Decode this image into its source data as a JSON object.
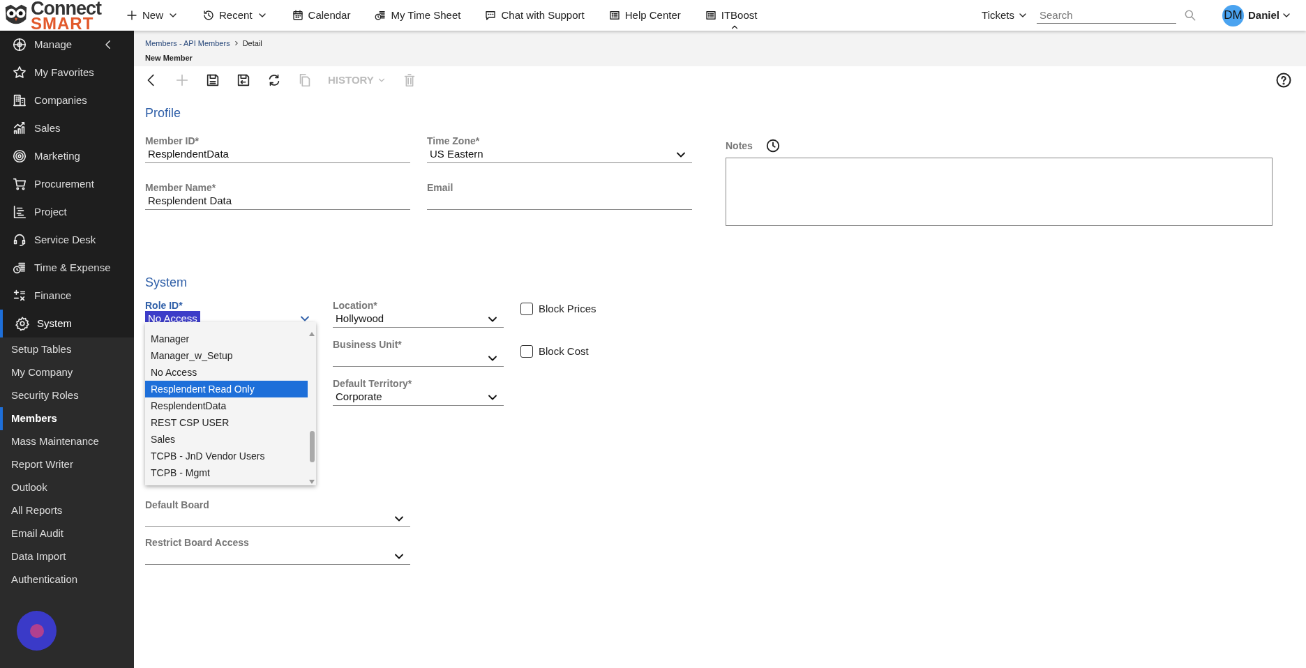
{
  "logo": {
    "line1": "Connect",
    "line2": "SMART"
  },
  "top_nav": [
    {
      "label": "New",
      "caret": true,
      "pointer": false
    },
    {
      "label": "Recent",
      "caret": true,
      "pointer": false
    },
    {
      "label": "Calendar",
      "caret": false,
      "pointer": false
    },
    {
      "label": "My Time Sheet",
      "caret": false,
      "pointer": false
    },
    {
      "label": "Chat with Support",
      "caret": false,
      "pointer": false
    },
    {
      "label": "Help Center",
      "caret": false,
      "pointer": false
    },
    {
      "label": "ITBoost",
      "caret": false,
      "pointer": true
    }
  ],
  "tickets_menu": "Tickets",
  "search": {
    "placeholder": "Search"
  },
  "user": {
    "initials": "DM",
    "name": "Daniel"
  },
  "sidebar": {
    "items": [
      {
        "label": "Manage",
        "selected": false
      },
      {
        "label": "My Favorites",
        "selected": false
      },
      {
        "label": "Companies",
        "selected": false
      },
      {
        "label": "Sales",
        "selected": false
      },
      {
        "label": "Marketing",
        "selected": false
      },
      {
        "label": "Procurement",
        "selected": false
      },
      {
        "label": "Project",
        "selected": false
      },
      {
        "label": "Service Desk",
        "selected": false
      },
      {
        "label": "Time & Expense",
        "selected": false
      },
      {
        "label": "Finance",
        "selected": false
      },
      {
        "label": "System",
        "selected": true
      }
    ],
    "sub_items": [
      {
        "label": "Setup Tables",
        "selected": false
      },
      {
        "label": "My Company",
        "selected": false
      },
      {
        "label": "Security Roles",
        "selected": false
      },
      {
        "label": "Members",
        "selected": true
      },
      {
        "label": "Mass Maintenance",
        "selected": false
      },
      {
        "label": "Report Writer",
        "selected": false
      },
      {
        "label": "Outlook",
        "selected": false
      },
      {
        "label": "All Reports",
        "selected": false
      },
      {
        "label": "Email Audit",
        "selected": false
      },
      {
        "label": "Data Import",
        "selected": false
      },
      {
        "label": "Authentication",
        "selected": false
      }
    ]
  },
  "breadcrumb": {
    "link": "Members - API Members",
    "current": "Detail",
    "page_title": "New Member"
  },
  "toolbar": [
    {
      "kind": "back",
      "disabled": false
    },
    {
      "kind": "add",
      "disabled": true
    },
    {
      "kind": "save",
      "disabled": false
    },
    {
      "kind": "save_close",
      "disabled": false
    },
    {
      "kind": "refresh",
      "disabled": false
    },
    {
      "kind": "copy",
      "disabled": true
    },
    {
      "kind": "history",
      "label": "HISTORY",
      "disabled": true
    },
    {
      "kind": "delete",
      "disabled": true
    }
  ],
  "profile": {
    "heading": "Profile",
    "fields": [
      {
        "label": "Member ID*",
        "value": "ResplendentData",
        "kind": "text",
        "focused": false
      },
      {
        "label": "Time Zone*",
        "value": "US Eastern",
        "kind": "select",
        "focused": false
      },
      {
        "label": "Member Name*",
        "value": "Resplendent Data",
        "kind": "text",
        "focused": false
      },
      {
        "label": "Email",
        "kind": "text",
        "focused": false
      }
    ],
    "notes": {
      "label": "Notes"
    }
  },
  "system": {
    "heading": "System",
    "role": {
      "label": "Role ID*",
      "value": "No Access",
      "kind": "select",
      "focused": true
    },
    "fields": [
      {
        "label": "Location*",
        "value": "Hollywood",
        "kind": "select",
        "focused": false
      },
      {
        "label": "Business Unit*",
        "kind": "select",
        "focused": false
      },
      {
        "label": "Default Territory*",
        "value": "Corporate",
        "kind": "select",
        "focused": false
      }
    ],
    "checkboxes": [
      {
        "label": "Block Prices",
        "checked": false
      },
      {
        "label": "Block Cost",
        "checked": false
      }
    ],
    "lower_fields": [
      {
        "label": "Default Board",
        "kind": "select",
        "focused": false
      },
      {
        "label": "Restrict Board Access",
        "kind": "select",
        "focused": false
      }
    ],
    "role_options": [
      {
        "label": "Manager",
        "selected": false
      },
      {
        "label": "Manager_w_Setup",
        "selected": false
      },
      {
        "label": "No Access",
        "selected": false
      },
      {
        "label": "Resplendent Read Only",
        "selected": true
      },
      {
        "label": "ResplendentData",
        "selected": false
      },
      {
        "label": "REST CSP USER",
        "selected": false
      },
      {
        "label": "Sales",
        "selected": false
      },
      {
        "label": "TCPB - JnD Vendor Users",
        "selected": false
      },
      {
        "label": "TCPB - Mgmt",
        "selected": false
      }
    ]
  }
}
